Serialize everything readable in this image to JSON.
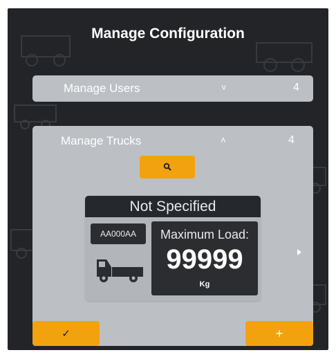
{
  "header": {
    "title": "Manage Configuration"
  },
  "sections": {
    "users": {
      "label": "Manage Users",
      "chevron": "˅",
      "count": "4",
      "expanded": false
    },
    "trucks": {
      "label": "Manage Trucks",
      "chevron": "˄",
      "count": "4",
      "expanded": true
    }
  },
  "truck": {
    "name": "Not Specified",
    "plate": "AA000AA",
    "load_label": "Maximum Load:",
    "load_value": "99999",
    "load_unit": "Kg",
    "icon": "truck-icon"
  },
  "actions": {
    "search_icon": "search-icon",
    "confirm_symbol": "✓",
    "add_symbol": "+",
    "next_icon": "chevron-right-icon"
  },
  "colors": {
    "accent": "#f2a20f",
    "background": "#222427",
    "panel": "#bcc0c5",
    "dark_box": "#2b2d31"
  }
}
